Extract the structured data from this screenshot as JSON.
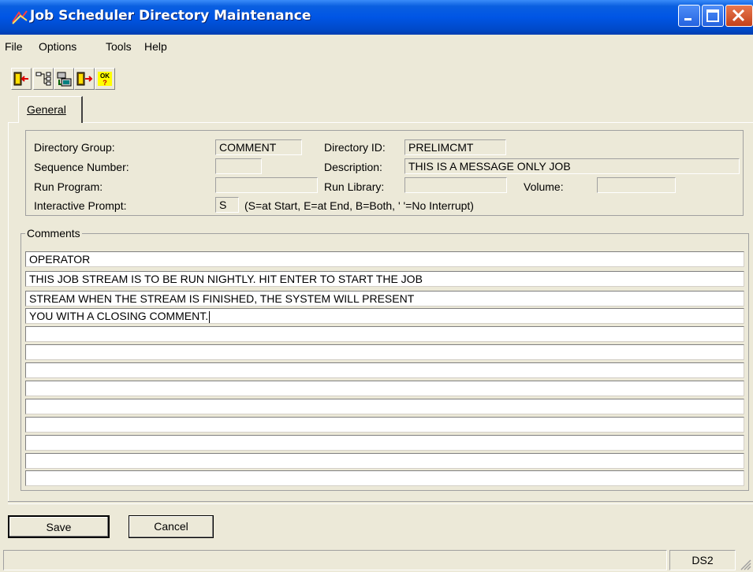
{
  "window": {
    "title": "Job Scheduler Directory Maintenance"
  },
  "menu": [
    "File",
    "Options",
    "Tools",
    "Help"
  ],
  "toolbar": {
    "icons": [
      "exit-icon",
      "tree-icon",
      "scheduler-icon",
      "door-arrow-icon",
      "ok-help-icon"
    ],
    "ok_glyph": "OK"
  },
  "tabs": [
    {
      "label": "General",
      "active": true
    }
  ],
  "form": {
    "directory_group_label": "Directory Group:",
    "directory_group_value": "COMMENT",
    "directory_id_label": "Directory ID:",
    "directory_id_value": "PRELIMCMT",
    "sequence_number_label": "Sequence Number:",
    "sequence_number_value": "",
    "description_label": "Description:",
    "description_value": "THIS IS A MESSAGE ONLY JOB",
    "run_program_label": "Run Program:",
    "run_program_value": "",
    "run_library_label": "Run Library:",
    "run_library_value": "",
    "volume_label": "Volume:",
    "volume_value": "",
    "interactive_prompt_label": "Interactive Prompt:",
    "interactive_prompt_value": "S",
    "interactive_prompt_hint": "(S=at Start, E=at End, B=Both, ' '=No Interrupt)"
  },
  "comments": {
    "legend": "Comments",
    "lines": [
      "OPERATOR",
      "THIS JOB STREAM IS TO BE RUN NIGHTLY. HIT ENTER TO START THE JOB",
      "STREAM WHEN THE STREAM IS FINISHED, THE SYSTEM WILL PRESENT",
      "YOU WITH A CLOSING COMMENT.",
      "",
      "",
      "",
      "",
      "",
      "",
      "",
      "",
      "",
      ""
    ]
  },
  "buttons": {
    "save": "Save",
    "cancel": "Cancel"
  },
  "status": {
    "main": "",
    "ds": "DS2"
  },
  "colors": {
    "titlebar": "#0055e5",
    "window_bg": "#ece9d8",
    "close_button": "#c2411a"
  }
}
